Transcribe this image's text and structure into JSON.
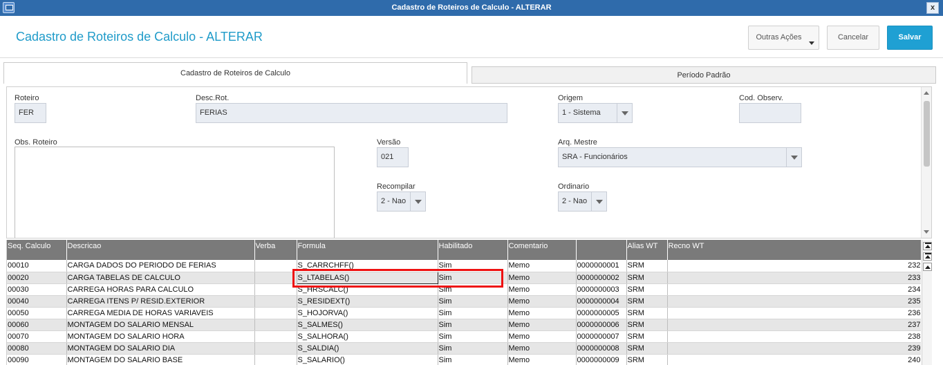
{
  "window": {
    "title": "Cadastro de Roteiros de Calculo - ALTERAR",
    "close_label": "x"
  },
  "header": {
    "title": "Cadastro de Roteiros de Calculo - ALTERAR",
    "outras_acoes": "Outras Ações",
    "cancelar": "Cancelar",
    "salvar": "Salvar"
  },
  "tabs": [
    {
      "label": "Cadastro de Roteiros de Calculo",
      "active": true
    },
    {
      "label": "Período Padrão",
      "active": false
    }
  ],
  "form": {
    "roteiro": {
      "label": "Roteiro",
      "value": "FER"
    },
    "desc_rot": {
      "label": "Desc.Rot.",
      "value": "FERIAS"
    },
    "origem": {
      "label": "Origem",
      "value": "1 - Sistema"
    },
    "cod_observ": {
      "label": "Cod. Observ.",
      "value": ""
    },
    "obs_roteiro": {
      "label": "Obs. Roteiro",
      "value": ""
    },
    "versao": {
      "label": "Versão",
      "value": "021"
    },
    "arq_mestre": {
      "label": "Arq. Mestre",
      "value": "SRA - Funcionários"
    },
    "recompilar": {
      "label": "Recompilar",
      "value": "2 - Nao"
    },
    "ordinario": {
      "label": "Ordinario",
      "value": "2 - Nao"
    }
  },
  "grid": {
    "columns": [
      "Seq. Calculo",
      "Descricao",
      "Verba",
      "Formula",
      "Habilitado",
      "Comentario",
      "",
      "Alias WT",
      "Recno WT"
    ],
    "rows": [
      [
        "00010",
        "CARGA DADOS DO PERIODO DE FERIAS",
        "",
        "S_CARRCHFF()",
        "Sim",
        "Memo",
        "0000000001",
        "SRM",
        "232"
      ],
      [
        "00020",
        "CARGA TABELAS DE CALCULO",
        "",
        "S_LTABELAS()",
        "Sim",
        "Memo",
        "0000000002",
        "SRM",
        "233"
      ],
      [
        "00030",
        "CARREGA HORAS PARA CALCULO",
        "",
        "S_HRSCALC()",
        "Sim",
        "Memo",
        "0000000003",
        "SRM",
        "234"
      ],
      [
        "00040",
        "CARREGA ITENS P/ RESID.EXTERIOR",
        "",
        "S_RESIDEXT()",
        "Sim",
        "Memo",
        "0000000004",
        "SRM",
        "235"
      ],
      [
        "00050",
        "CARREGA MEDIA DE HORAS VARIAVEIS",
        "",
        "S_HOJORVA()",
        "Sim",
        "Memo",
        "0000000005",
        "SRM",
        "236"
      ],
      [
        "00060",
        "MONTAGEM DO SALARIO MENSAL",
        "",
        "S_SALMES()",
        "Sim",
        "Memo",
        "0000000006",
        "SRM",
        "237"
      ],
      [
        "00070",
        "MONTAGEM DO SALARIO HORA",
        "",
        "S_SALHORA()",
        "Sim",
        "Memo",
        "0000000007",
        "SRM",
        "238"
      ],
      [
        "00080",
        "MONTAGEM DO SALARIO DIA",
        "",
        "S_SALDIA()",
        "Sim",
        "Memo",
        "0000000008",
        "SRM",
        "239"
      ],
      [
        "00090",
        "MONTAGEM DO SALARIO BASE",
        "",
        "S_SALARIO()",
        "Sim",
        "Memo",
        "0000000009",
        "SRM",
        "240"
      ]
    ]
  }
}
